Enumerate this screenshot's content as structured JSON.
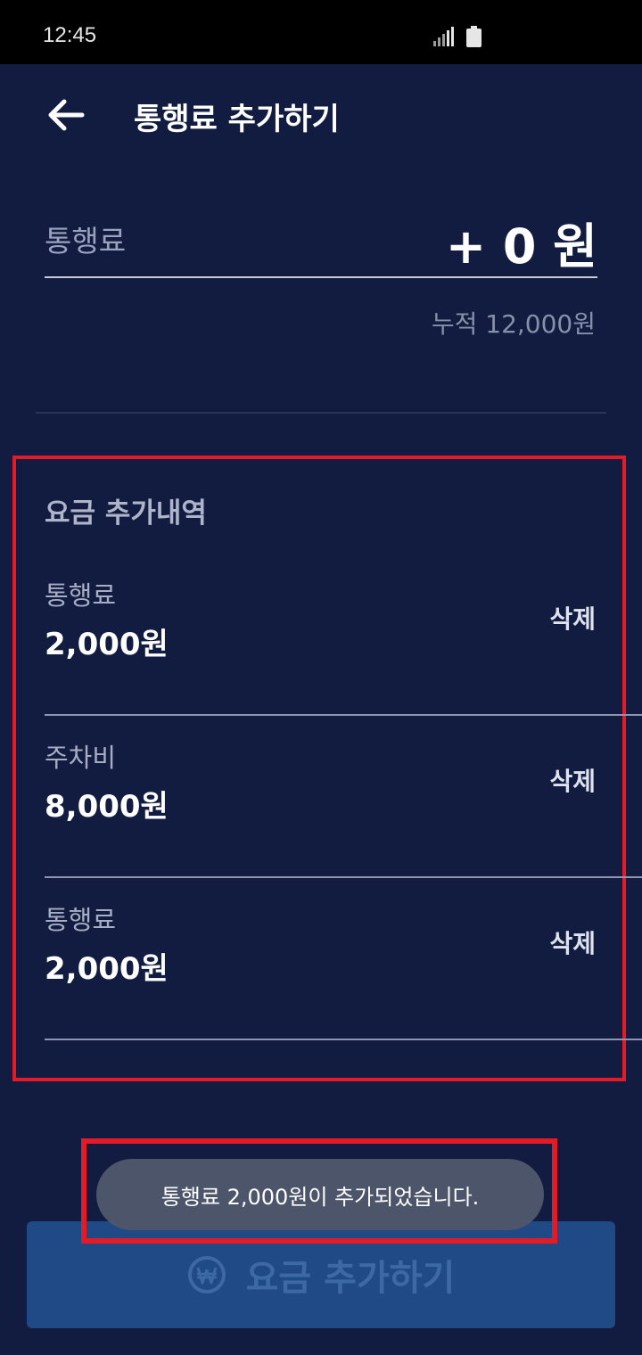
{
  "status_bar": {
    "time": "12:45",
    "icons": [
      "signal-icon",
      "battery-icon"
    ]
  },
  "header": {
    "back_icon": "back-arrow-icon",
    "title": "통행료 추가하기"
  },
  "fee_input": {
    "label": "통행료",
    "amount": "+ 0 원",
    "cumulative": "누적 12,000원"
  },
  "history": {
    "title": "요금 추가내역",
    "items": [
      {
        "label": "통행료",
        "amount": "2,000원",
        "delete_label": "삭제"
      },
      {
        "label": "주차비",
        "amount": "8,000원",
        "delete_label": "삭제"
      },
      {
        "label": "통행료",
        "amount": "2,000원",
        "delete_label": "삭제"
      }
    ]
  },
  "toast": {
    "message": "통행료 2,000원이 추가되었습니다."
  },
  "add_button": {
    "icon": "won-icon",
    "label": "요금 추가하기"
  },
  "colors": {
    "background": "#121c40",
    "highlight": "#e21b26",
    "button": "#1f4a86",
    "toast": "#4c556a"
  }
}
